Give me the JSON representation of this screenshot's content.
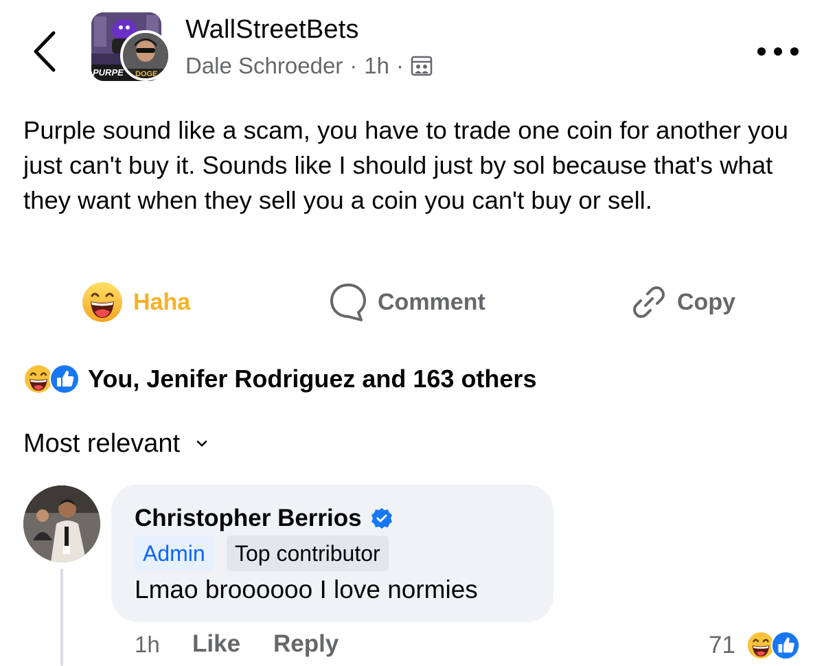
{
  "header": {
    "group_name": "WallStreetBets",
    "author": "Dale Schroeder",
    "separator": "·",
    "time": "1h",
    "avatar_text_left": "PURPE",
    "avatar_text_right": "DOGE"
  },
  "post": {
    "text": "Purple sound like a scam, you have to trade one coin for another you just can't buy it. Sounds like I should just by sol because that's what they want when they sell you a coin you can't buy or sell."
  },
  "actions": {
    "haha_label": "Haha",
    "comment_label": "Comment",
    "copy_label": "Copy"
  },
  "reactions_summary": {
    "text": "You, Jenifer Rodriguez and 163 others"
  },
  "comments_sort": {
    "label": "Most relevant"
  },
  "comment": {
    "author": "Christopher Berrios",
    "badge_admin": "Admin",
    "badge_top": "Top contributor",
    "text": "Lmao broooooo I love normies",
    "time": "1h",
    "like_label": "Like",
    "reply_label": "Reply",
    "reaction_count": "71"
  },
  "colors": {
    "haha_accent": "#f7b125",
    "secondary_text": "#65676b",
    "link_blue": "#0866ff",
    "bubble_bg": "#f0f2f5"
  }
}
